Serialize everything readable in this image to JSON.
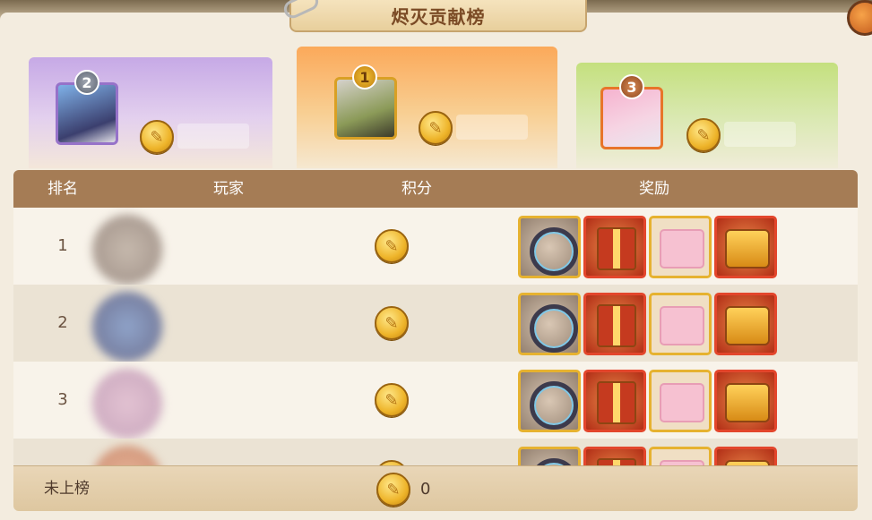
{
  "title": "烬灭贡献榜",
  "podium": [
    {
      "rank": "2",
      "icon": "coin-icon"
    },
    {
      "rank": "1",
      "icon": "coin-icon"
    },
    {
      "rank": "3",
      "icon": "coin-icon"
    }
  ],
  "table": {
    "headers": {
      "rank": "排名",
      "player": "玩家",
      "score": "积分",
      "reward": "奖励"
    },
    "rows": [
      {
        "rank": "1",
        "rewards": [
          "ring-icon",
          "gift-box-icon",
          "avatar-frame-icon",
          "treasure-chest-icon"
        ]
      },
      {
        "rank": "2",
        "rewards": [
          "ring-icon",
          "gift-box-icon",
          "avatar-frame-icon",
          "treasure-chest-icon"
        ]
      },
      {
        "rank": "3",
        "rewards": [
          "ring-icon",
          "gift-box-icon",
          "avatar-frame-icon",
          "treasure-chest-icon"
        ]
      }
    ]
  },
  "footer": {
    "label": "未上榜",
    "value": "0"
  },
  "colors": {
    "header": "#a57c55",
    "rank1": "#fba95a",
    "rank2": "#c6a9e6",
    "rank3": "#c4e07e"
  }
}
